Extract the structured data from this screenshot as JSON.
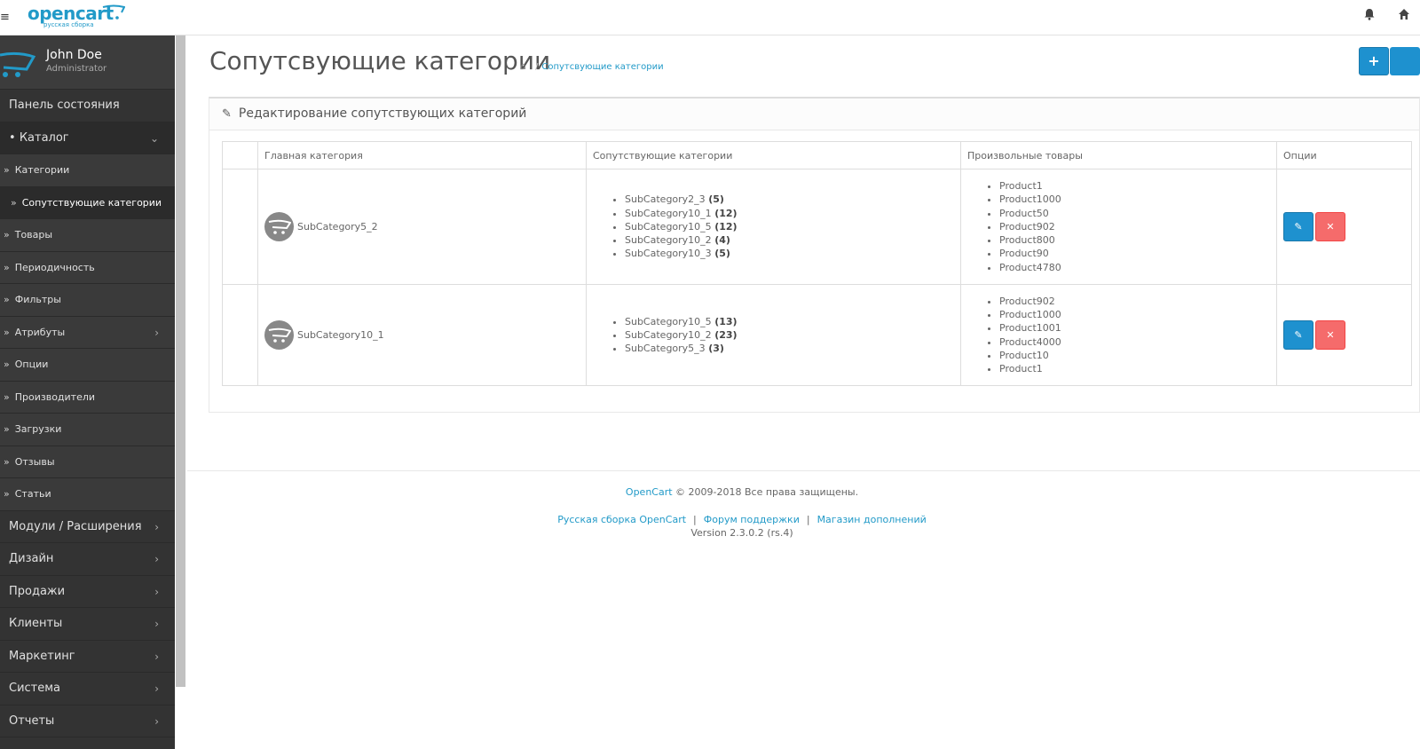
{
  "app": {
    "brand": "opencart",
    "brand_sub": "русская сборка"
  },
  "user": {
    "name": "John Doe",
    "role": "Administrator"
  },
  "sidebar": {
    "items": [
      {
        "label": "Панель состояния"
      },
      {
        "label": "Каталог"
      },
      {
        "label": "Категории"
      },
      {
        "label": "Сопутствующие категории"
      },
      {
        "label": "Товары"
      },
      {
        "label": "Периодичность"
      },
      {
        "label": "Фильтры"
      },
      {
        "label": "Атрибуты"
      },
      {
        "label": "Опции"
      },
      {
        "label": "Производители"
      },
      {
        "label": "Загрузки"
      },
      {
        "label": "Отзывы"
      },
      {
        "label": "Статьи"
      },
      {
        "label": "Модули / Расширения"
      },
      {
        "label": "Дизайн"
      },
      {
        "label": "Продажи"
      },
      {
        "label": "Клиенты"
      },
      {
        "label": "Маркетинг"
      },
      {
        "label": "Система"
      },
      {
        "label": "Отчеты"
      }
    ]
  },
  "page": {
    "title": "Сопутсвующие категории",
    "breadcrumb_current": "Сопутсвующие категории",
    "add_button": "+"
  },
  "panel": {
    "heading": "Редактирование сопутствующих категорий",
    "columns": [
      "Главная категория",
      "Сопутствующие категории",
      "Произвольные товары",
      "Опции"
    ],
    "rows": [
      {
        "main_category": "SubCategory5_2",
        "related": [
          {
            "name": "SubCategory2_3",
            "count": "(5)"
          },
          {
            "name": "SubCategory10_1",
            "count": "(12)"
          },
          {
            "name": "SubCategory10_5",
            "count": "(12)"
          },
          {
            "name": "SubCategory10_2",
            "count": "(4)"
          },
          {
            "name": "SubCategory10_3",
            "count": "(5)"
          }
        ],
        "products": [
          "Product1",
          "Product1000",
          "Product50",
          "Product902",
          "Product800",
          "Product90",
          "Product4780"
        ]
      },
      {
        "main_category": "SubCategory10_1",
        "related": [
          {
            "name": "SubCategory10_5",
            "count": "(13)"
          },
          {
            "name": "SubCategory10_2",
            "count": "(23)"
          },
          {
            "name": "SubCategory5_3",
            "count": "(3)"
          }
        ],
        "products": [
          "Product902",
          "Product1000",
          "Product1001",
          "Product4000",
          "Product10",
          "Product1"
        ]
      }
    ]
  },
  "footer": {
    "brand_link": "OpenCart",
    "copyright": "© 2009-2018 Все права защищены.",
    "link1": "Русская сборка OpenCart",
    "link2": "Форум поддержки",
    "link3": "Магазин дополнений",
    "version": "Version 2.3.0.2 (rs.4)"
  },
  "colors": {
    "primary": "#1e91cf",
    "danger": "#f56b6b",
    "sidebar": "#333333",
    "link": "#229ac8"
  }
}
